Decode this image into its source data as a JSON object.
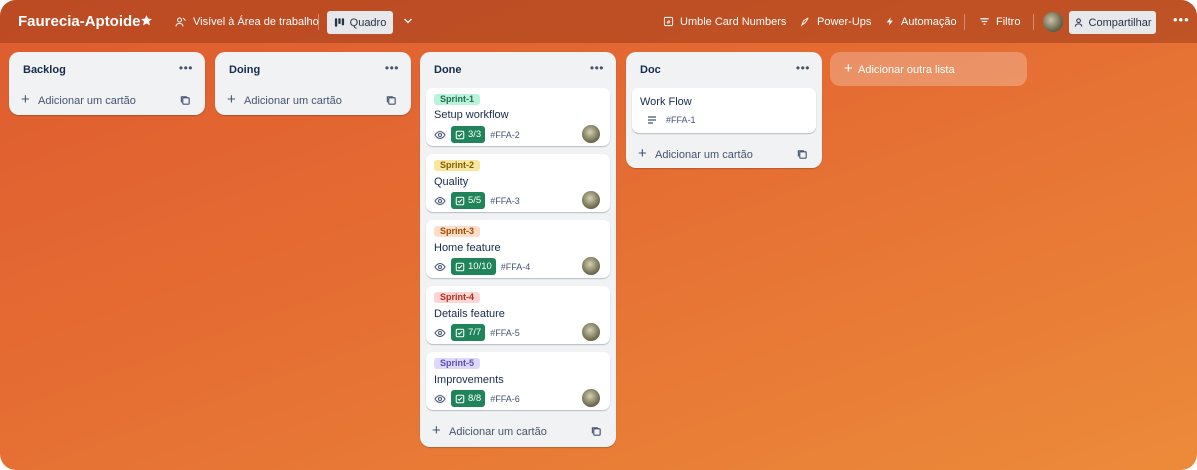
{
  "board": {
    "title": "Faurecia-Aptoide",
    "visibility": "Visível à Área de trabalho",
    "view": "Quadro",
    "accent": "#e56d33"
  },
  "toolbar": {
    "umble": "Umble Card Numbers",
    "powerups": "Power-Ups",
    "automation": "Automação",
    "filter": "Filtro",
    "share": "Compartilhar"
  },
  "add_card_label": "Adicionar um cartão",
  "add_list_label": "Adicionar outra lista",
  "lists": [
    {
      "title": "Backlog"
    },
    {
      "title": "Doing"
    },
    {
      "title": "Done",
      "cards": [
        {
          "label": "Sprint-1",
          "title": "Setup workflow",
          "checklist": "3/3",
          "id": "#FFA-2"
        },
        {
          "label": "Sprint-2",
          "title": "Quality",
          "checklist": "5/5",
          "id": "#FFA-3"
        },
        {
          "label": "Sprint-3",
          "title": "Home feature",
          "checklist": "10/10",
          "id": "#FFA-4"
        },
        {
          "label": "Sprint-4",
          "title": "Details feature",
          "checklist": "7/7",
          "id": "#FFA-5"
        },
        {
          "label": "Sprint-5",
          "title": "Improvements",
          "checklist": "8/8",
          "id": "#FFA-6"
        }
      ]
    },
    {
      "title": "Doc",
      "cards": [
        {
          "title": "Work Flow",
          "id": "#FFA-1"
        }
      ]
    }
  ],
  "label_colors": {
    "sprint1": {
      "bg": "#baf3db",
      "fg": "#216e4e"
    },
    "sprint2": {
      "bg": "#f8e6a0",
      "fg": "#7f5f01"
    },
    "sprint3": {
      "bg": "#fedec8",
      "fg": "#a54800"
    },
    "sprint4": {
      "bg": "#ffd5d2",
      "fg": "#ae2e24"
    },
    "sprint5": {
      "bg": "#dfd8fd",
      "fg": "#5e4db2"
    }
  },
  "icons": [
    "star-icon",
    "people-icon",
    "board-icon",
    "chevron-down-icon",
    "umble-icon",
    "rocket-icon",
    "bolt-icon",
    "filter-icon",
    "person-add-icon",
    "more-icon",
    "eye-icon",
    "checklist-icon",
    "description-icon",
    "template-icon",
    "plus-icon"
  ]
}
